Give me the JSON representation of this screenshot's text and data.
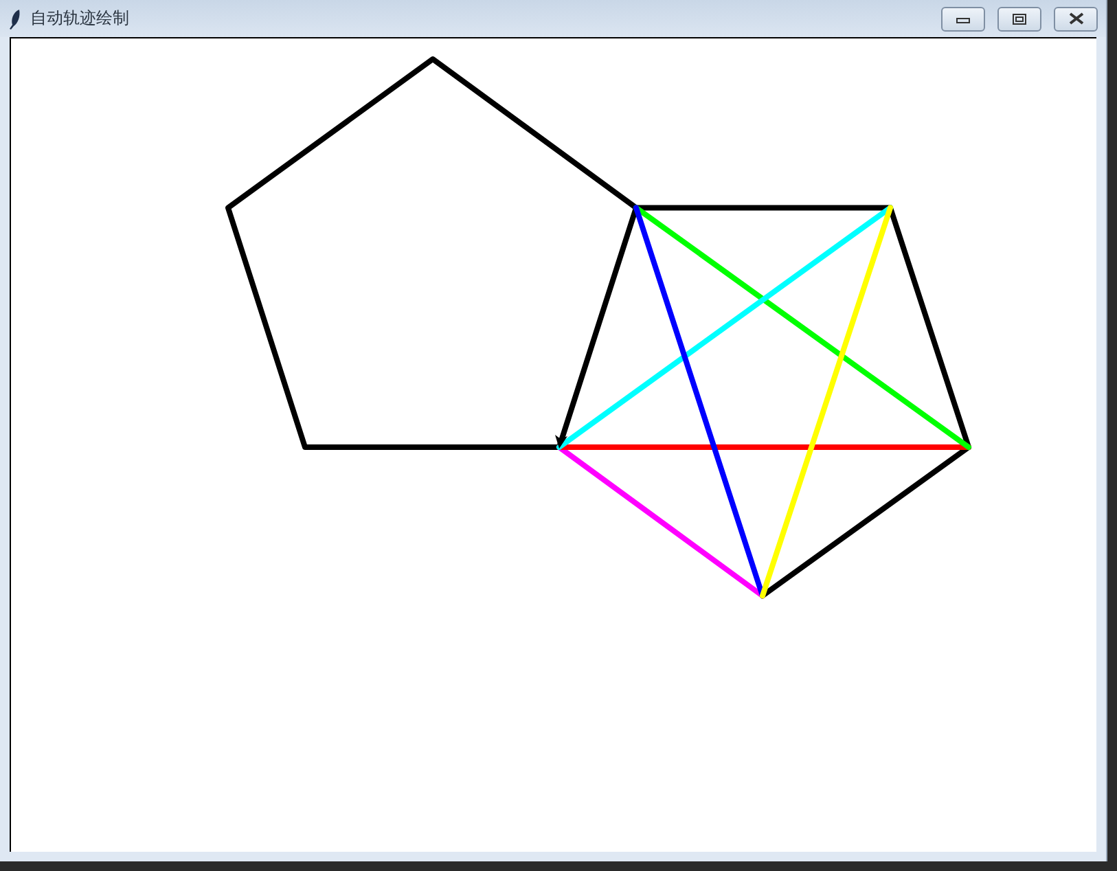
{
  "window": {
    "title": "自动轨迹绘制"
  }
}
